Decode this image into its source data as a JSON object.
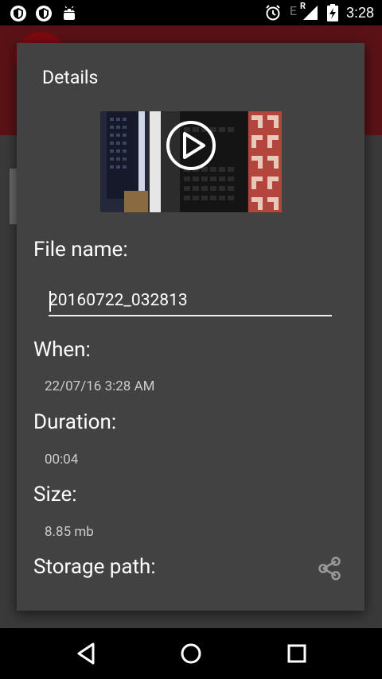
{
  "status_bar": {
    "time": "3:28",
    "network_letter": "E",
    "roaming_letter": "R",
    "icons": [
      "shield-icon",
      "shield-icon",
      "android-icon",
      "alarm-icon",
      "signal-icon",
      "battery-charging-icon"
    ]
  },
  "dialog": {
    "title": "Details",
    "file_name_label": "File name:",
    "file_name_value": "20160722_032813",
    "when_label": "When:",
    "when_value": "22/07/16 3:28 AM",
    "duration_label": "Duration:",
    "duration_value": "00:04",
    "size_label": "Size:",
    "size_value": "8.85 mb",
    "storage_path_label": "Storage path:",
    "icons": [
      "play-icon",
      "share-icon"
    ]
  },
  "nav_bar": {
    "icons": [
      "back-icon",
      "home-icon",
      "recents-icon"
    ]
  },
  "colors": {
    "dialog_bg": "#424242",
    "app_header": "#5a1216",
    "status_bar": "#000000"
  }
}
